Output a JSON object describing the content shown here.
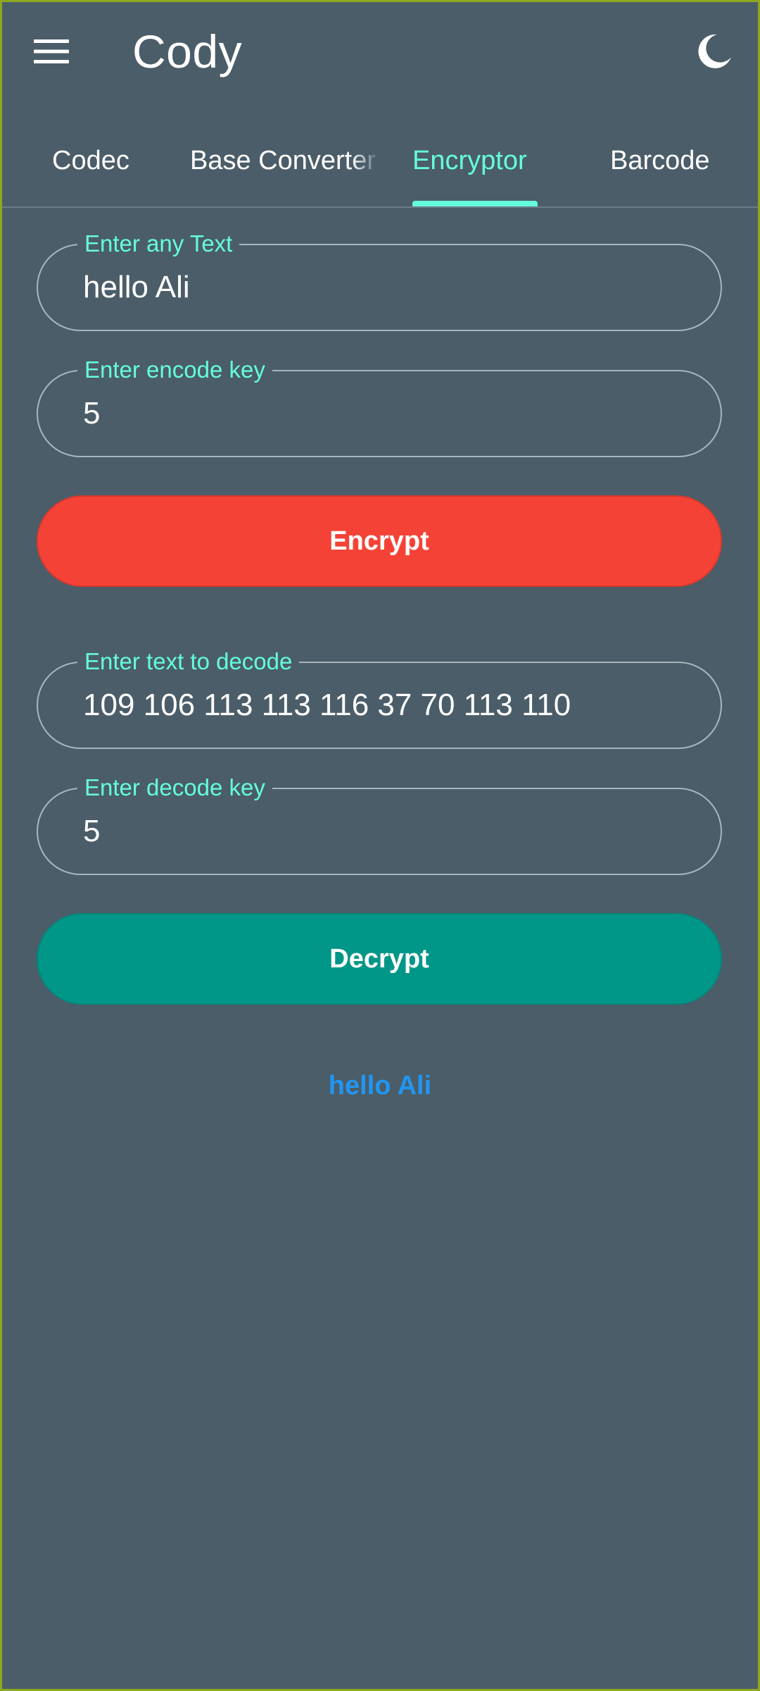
{
  "app": {
    "title": "Cody"
  },
  "tabs": [
    {
      "label": "Codec"
    },
    {
      "label": "Base Converter"
    },
    {
      "label": "Encryptor"
    },
    {
      "label": "Barcode"
    }
  ],
  "active_tab": "Encryptor",
  "encrypt": {
    "text_label": "Enter any Text",
    "text_value": "hello Ali",
    "key_label": "Enter encode key",
    "key_value": "5",
    "button_label": "Encrypt"
  },
  "decrypt": {
    "text_label": "Enter text to decode",
    "text_value": "109 106 113 113 116 37 70 113 110",
    "key_label": "Enter decode key",
    "key_value": "5",
    "button_label": "Decrypt"
  },
  "result": {
    "text": "hello Ali"
  },
  "icons": {
    "menu": "menu-icon",
    "theme": "moon-icon"
  },
  "colors": {
    "background": "#4b5d68",
    "accent": "#64ffda",
    "encrypt_button": "#f44336",
    "decrypt_button": "#009688",
    "result_text": "#2196f3"
  }
}
